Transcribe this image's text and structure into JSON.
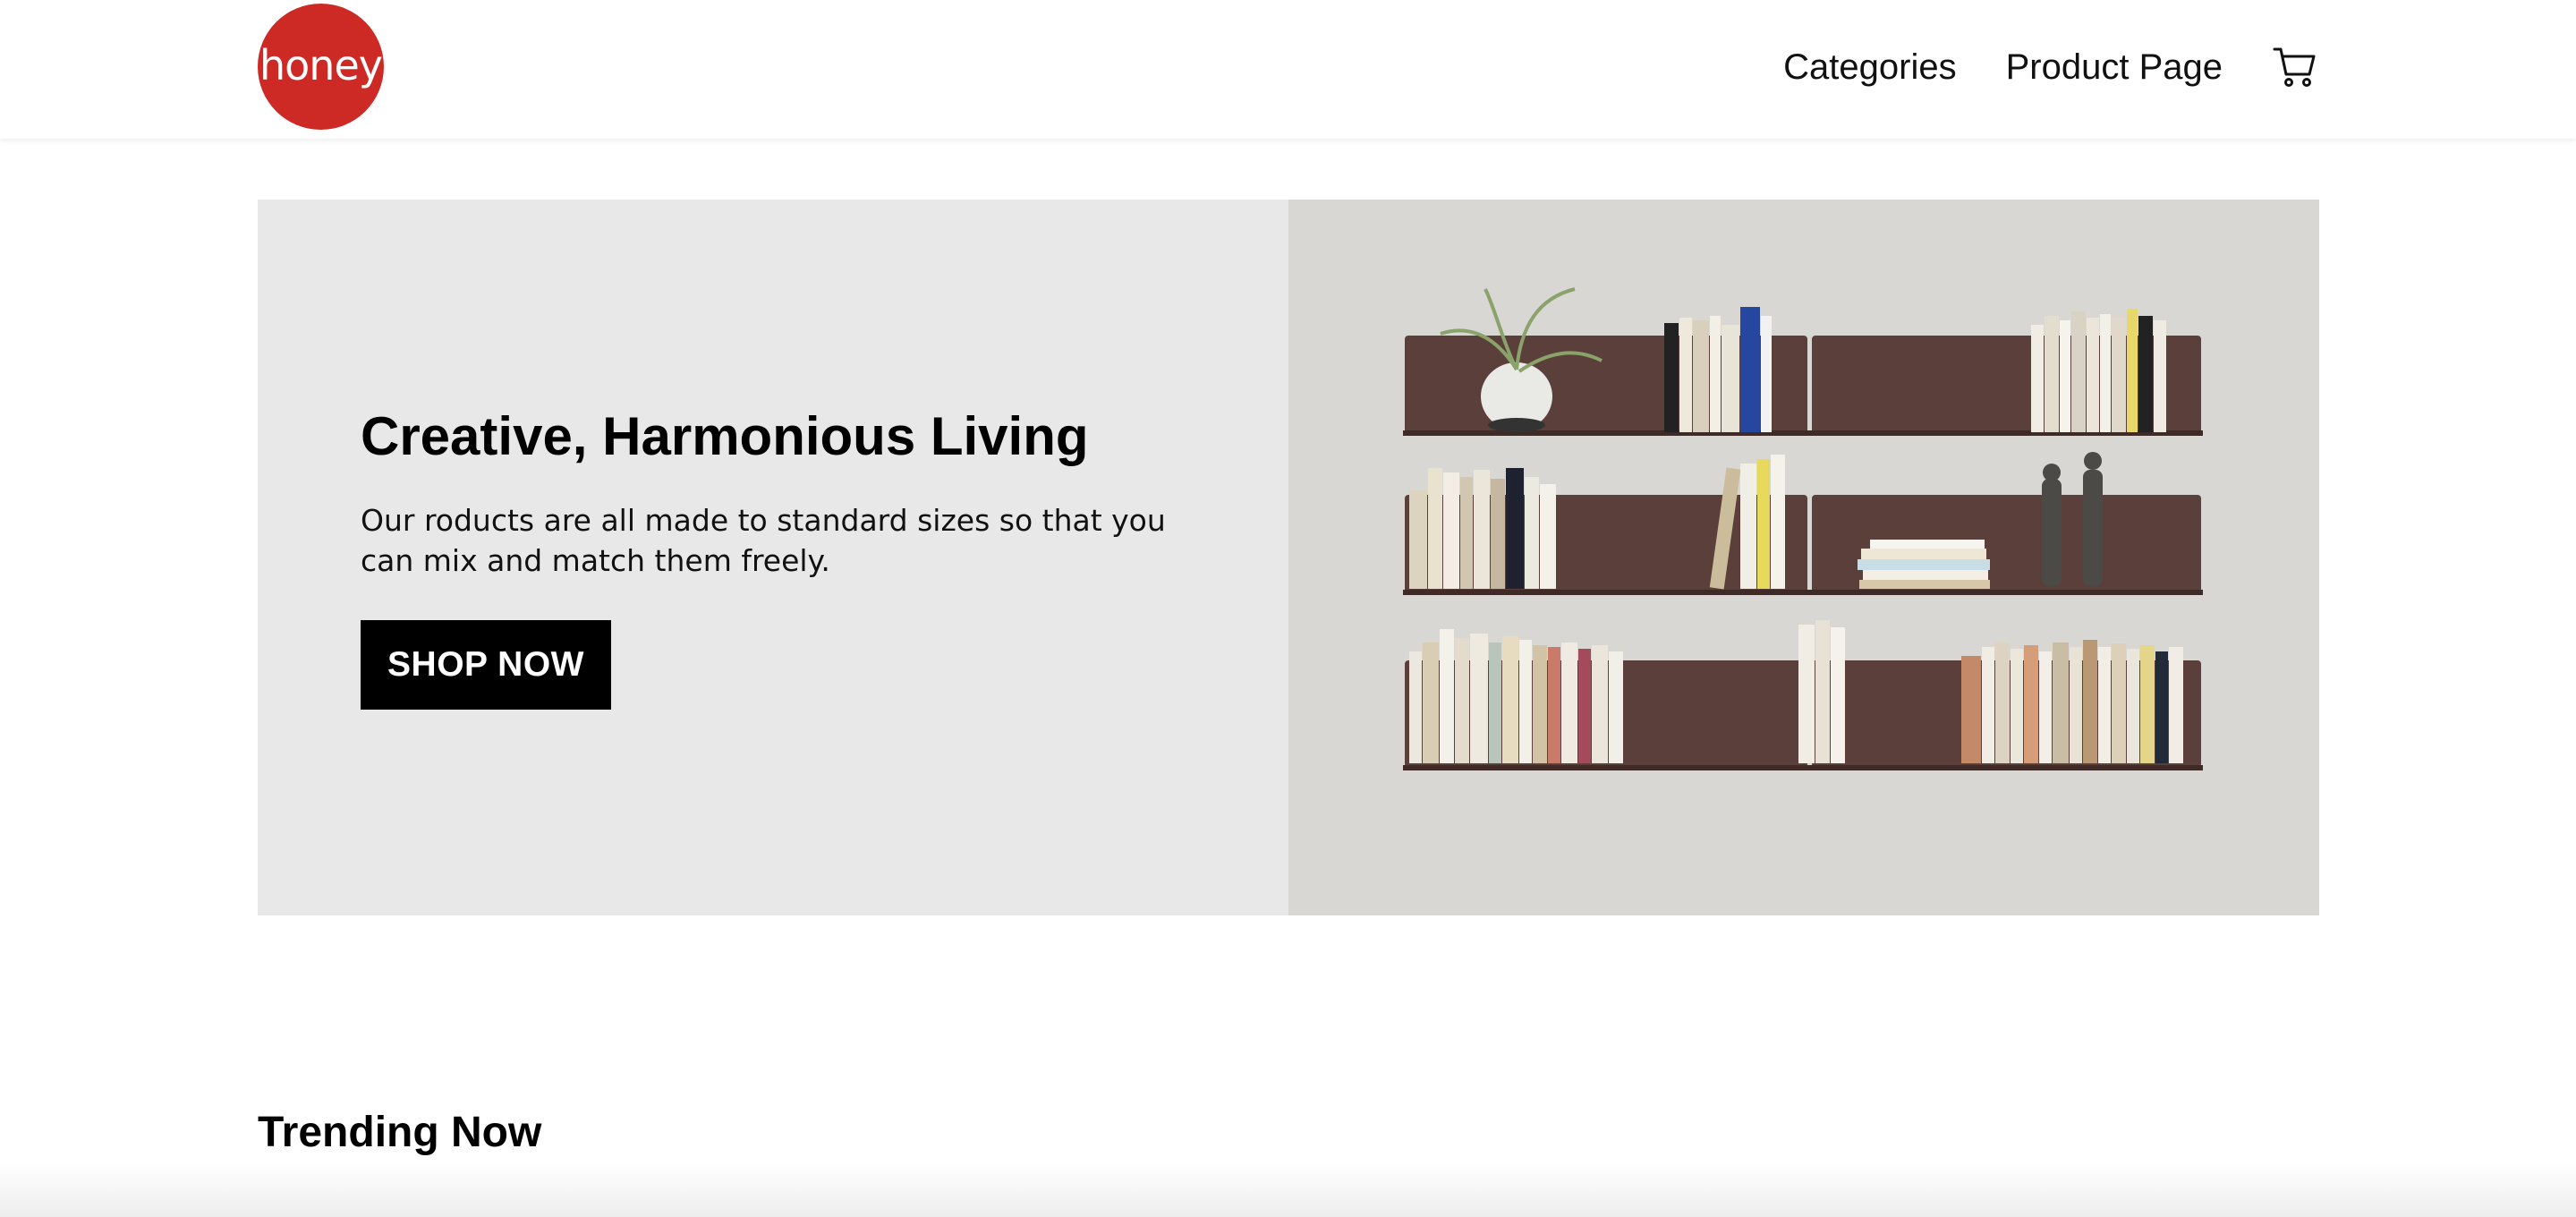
{
  "header": {
    "logo_text": "honey",
    "nav": [
      {
        "label": "Categories"
      },
      {
        "label": "Product Page"
      }
    ],
    "cart_icon": "cart-icon"
  },
  "hero": {
    "title": "Creative, Harmonious Living",
    "subtitle": "Our roducts are all made to standard sizes so that you can mix and match them freely.",
    "cta_label": "SHOP NOW",
    "image": "bookshelf-photo"
  },
  "sections": {
    "trending_title": "Trending Now"
  },
  "colors": {
    "brand": "#cd2a26",
    "hero_bg": "#e8e8e8",
    "cta_bg": "#000000"
  }
}
